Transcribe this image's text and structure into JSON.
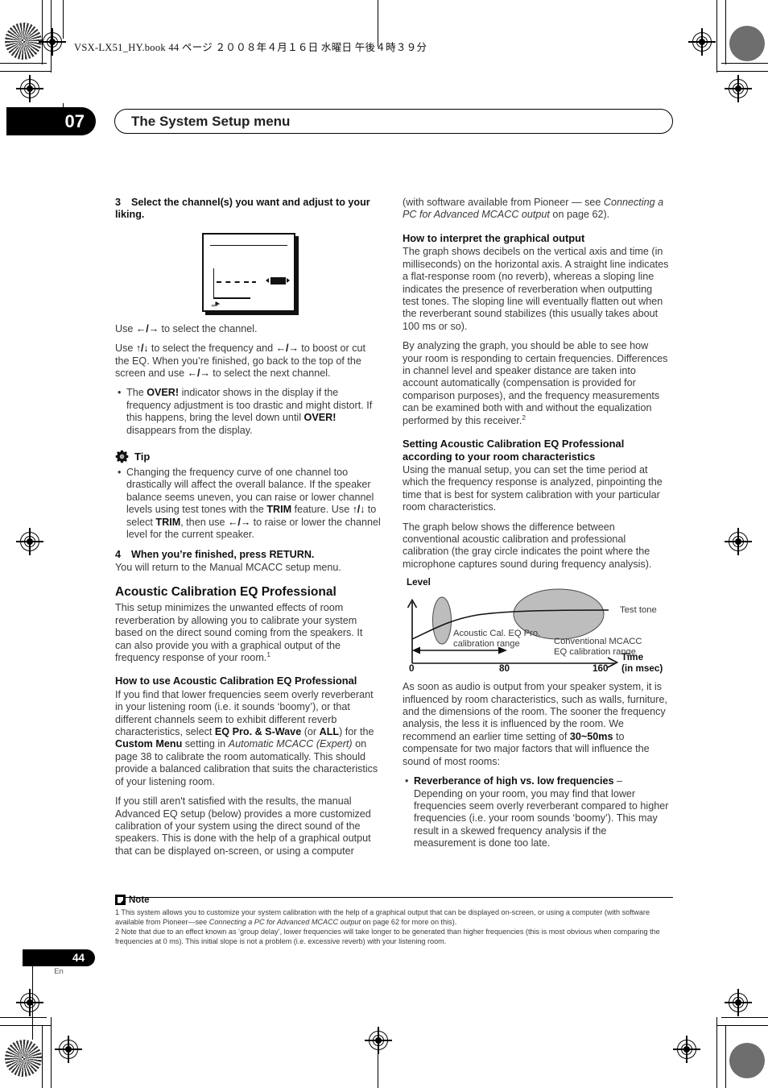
{
  "print_marks": {
    "job_line": "VSX-LX51_HY.book   44 ページ   ２００８年４月１６日   水曜日   午後４時３９分"
  },
  "header": {
    "chapter_number": "07",
    "chapter_title": "The System Setup menu"
  },
  "left_column": {
    "step3": {
      "num": "3",
      "title": "Select the channel(s) you want and adjust to your liking."
    },
    "osd_caption": "on-screen-display-illustration",
    "use_channel": "to select the channel.",
    "use_channel_pre": "Use",
    "use_freq_1": "Use",
    "use_freq_2": "to select the frequency and",
    "use_freq_3": "to boost or cut the EQ. When you’re finished, go back to the top of the screen and use",
    "use_freq_4": "to select the next channel.",
    "over_bullet_1": "The ",
    "over_label": "OVER!",
    "over_bullet_2": " indicator shows in the display if the frequency adjustment is too drastic and might distort. If this happens, bring the level down until ",
    "over_bullet_3": " disappears from the display.",
    "tip_label": "Tip",
    "tip_bullet_a": "Changing the frequency curve of one channel too drastically will affect the overall balance. If the speaker balance seems uneven, you can raise or lower channel levels using test tones with the ",
    "tip_trim_1": "TRIM",
    "tip_bullet_b": " feature. Use ",
    "tip_bullet_c": " to select ",
    "tip_trim_2": "TRIM",
    "tip_bullet_d": ", then use ",
    "tip_bullet_e": " to raise or lower the channel level for the current speaker.",
    "step4": {
      "num": "4",
      "title": "When you’re finished, press RETURN.",
      "body": "You will return to the Manual MCACC setup menu."
    },
    "h2_acoustic": "Acoustic Calibration EQ Professional",
    "p_acoustic": "This setup minimizes the unwanted effects of room reverberation by allowing you to calibrate your system based on the direct sound coming from the speakers. It can also provide you with a graphical output of the frequency response of your room.",
    "p_acoustic_sup": "1",
    "h3_howto": "How to use Acoustic Calibration EQ Professional",
    "p_howto_1": "If you find that lower frequencies seem overly reverberant in your listening room (i.e. it sounds ‘boomy’), or that different channels seem to exhibit different reverb characteristics, select ",
    "b_eqpro": "EQ Pro. & S-Wave",
    "p_howto_2": " (or ",
    "b_all": "ALL",
    "p_howto_3": ") for the ",
    "b_custom": "Custom Menu",
    "p_howto_4": " setting in ",
    "i_autommcacc": "Automatic MCACC (Expert)",
    "p_howto_5": " on page 38 to calibrate the room automatically. This should provide a balanced calibration that suits the characteristics of your listening room.",
    "p_howto_6": "If you still aren't satisfied with the results, the manual Advanced EQ setup (below) provides a more customized calibration of your system using the direct sound of the speakers. This is done with the help of a graphical output that can be displayed on-screen, or using a computer"
  },
  "right_column": {
    "p_cont_1": "(with software available from Pioneer — see ",
    "i_connecting": "a PC for Advanced MCACC output",
    "i_connecting_head": "Connecting",
    "p_cont_2": " on page 62).",
    "h3_interpret": "How to interpret the graphical output",
    "p_interpret_1": "The graph shows decibels on the vertical axis and time (in milliseconds) on the horizontal axis. A straight line indicates a flat-response room (no reverb), whereas a sloping line indicates the presence of reverberation when outputting test tones. The sloping line will eventually flatten out when the reverberant sound stabilizes (this usually takes about 100 ms or so).",
    "p_interpret_2": "By analyzing the graph, you should be able to see how your room is responding to certain frequencies. Differences in channel level and speaker distance are taken into account automatically (compensation is provided for comparison purposes), and the frequency measurements can be examined both with and without the equalization performed by this receiver.",
    "p_interpret_2_sup": "2",
    "h3_setting": "Setting Acoustic Calibration EQ Professional according to your room characteristics",
    "p_setting_1": "Using the manual setup, you can set the time period at which the frequency response is analyzed, pinpointing the time that is best for system calibration with your particular room characteristics.",
    "p_setting_2": "The graph below shows the difference between conventional acoustic calibration and professional calibration (the gray circle indicates the point where the microphone captures sound during frequency analysis).",
    "p_after_1": "As soon as audio is output from your speaker system, it is influenced by room characteristics, such as walls, furniture, and the dimensions of the room. The sooner the frequency analysis, the less it is influenced by the room. We recommend an earlier time setting of ",
    "b_3050": "30~50ms",
    "p_after_2": " to compensate for two major factors that will influence the sound of most rooms:",
    "bullet_rev_title": "Reverberance of high vs. low frequencies",
    "bullet_rev_dash": " – ",
    "bullet_rev_body": "Depending on your room, you may find that lower frequencies seem overly reverberant compared to higher frequencies (i.e. your room sounds ‘boomy’). This may result in a skewed frequency analysis if the measurement is done too late."
  },
  "chart_data": {
    "type": "line",
    "title": "",
    "xlabel": "Time",
    "xlabel_sub": "(in msec)",
    "ylabel": "Level",
    "x_ticks": [
      "0",
      "80",
      "160"
    ],
    "x_tick_values": [
      0,
      80,
      160
    ],
    "xlim": [
      0,
      175
    ],
    "grid": false,
    "series": [
      {
        "name": "Test tone",
        "label": "Test tone",
        "description": "rising reverberation curve that flattens out after ~80 ms",
        "x": [
          0,
          10,
          20,
          30,
          40,
          55,
          70,
          85,
          100,
          130,
          160,
          175
        ],
        "y": [
          0.3,
          0.44,
          0.55,
          0.63,
          0.7,
          0.77,
          0.82,
          0.85,
          0.86,
          0.87,
          0.87,
          0.87
        ]
      }
    ],
    "annotations": [
      {
        "name": "acoustic-cal-eq-pro-ellipse",
        "shape": "ellipse",
        "fill": "#bfbfbf",
        "center_x": 18,
        "center_y": 0.62,
        "label": "Acoustic Cal. EQ Pro.\ncalibration range"
      },
      {
        "name": "conventional-mcacc-ellipse",
        "shape": "ellipse",
        "fill": "#bfbfbf",
        "center_x": 120,
        "center_y": 0.87,
        "label": "Conventional MCACC\nEQ calibration range"
      },
      {
        "name": "calibration-range-arrow",
        "shape": "double-arrow",
        "from_x": 0,
        "to_x": 80
      }
    ],
    "labels": {
      "test_tone": "Test tone",
      "acoustic_range_l1": "Acoustic Cal. EQ Pro.",
      "acoustic_range_l2": "calibration range",
      "conventional_l1": "Conventional MCACC",
      "conventional_l2": "EQ calibration range"
    }
  },
  "notes": {
    "heading": "Note",
    "note_1": "1 This system allows you to customize your system calibration with the help of a graphical output that can be displayed on-screen, or using a computer (with software available from Pioneer—see ",
    "note_1_italic": "Connecting a PC for Advanced MCACC output",
    "note_1_tail": " on page 62 for more on this).",
    "note_2": "2 Note that due to an effect known as ‘group delay’, lower frequencies will take longer to be generated than higher frequencies (this is most obvious when comparing the frequencies at 0 ms). This initial slope is not a problem (i.e. excessive reverb) with your listening room."
  },
  "footer": {
    "page_number": "44",
    "language": "En"
  }
}
